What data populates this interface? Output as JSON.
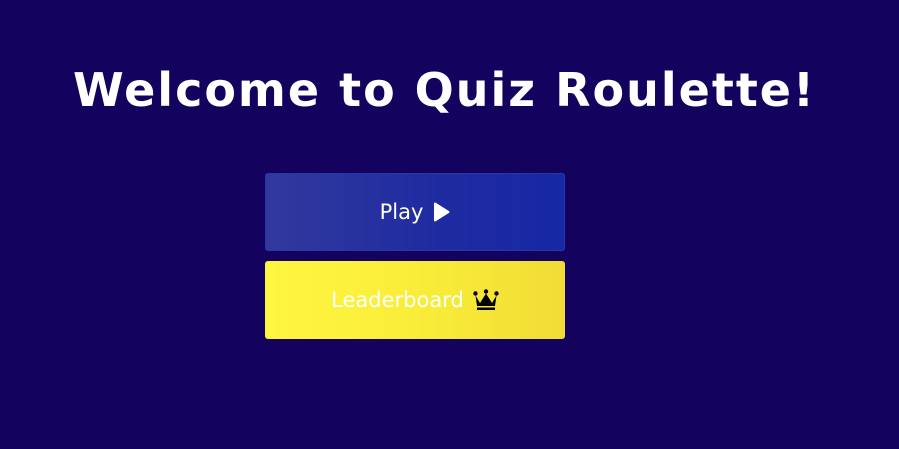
{
  "page": {
    "title": "Welcome to Quiz Roulette!"
  },
  "buttons": {
    "play": {
      "label": "Play",
      "icon": "play-icon"
    },
    "leaderboard": {
      "label": "Leaderboard",
      "icon": "crown-icon"
    }
  },
  "colors": {
    "background": "#13025e",
    "play_button": "#1e2aa0",
    "leaderboard_button": "#f9ec38",
    "text": "#ffffff"
  }
}
